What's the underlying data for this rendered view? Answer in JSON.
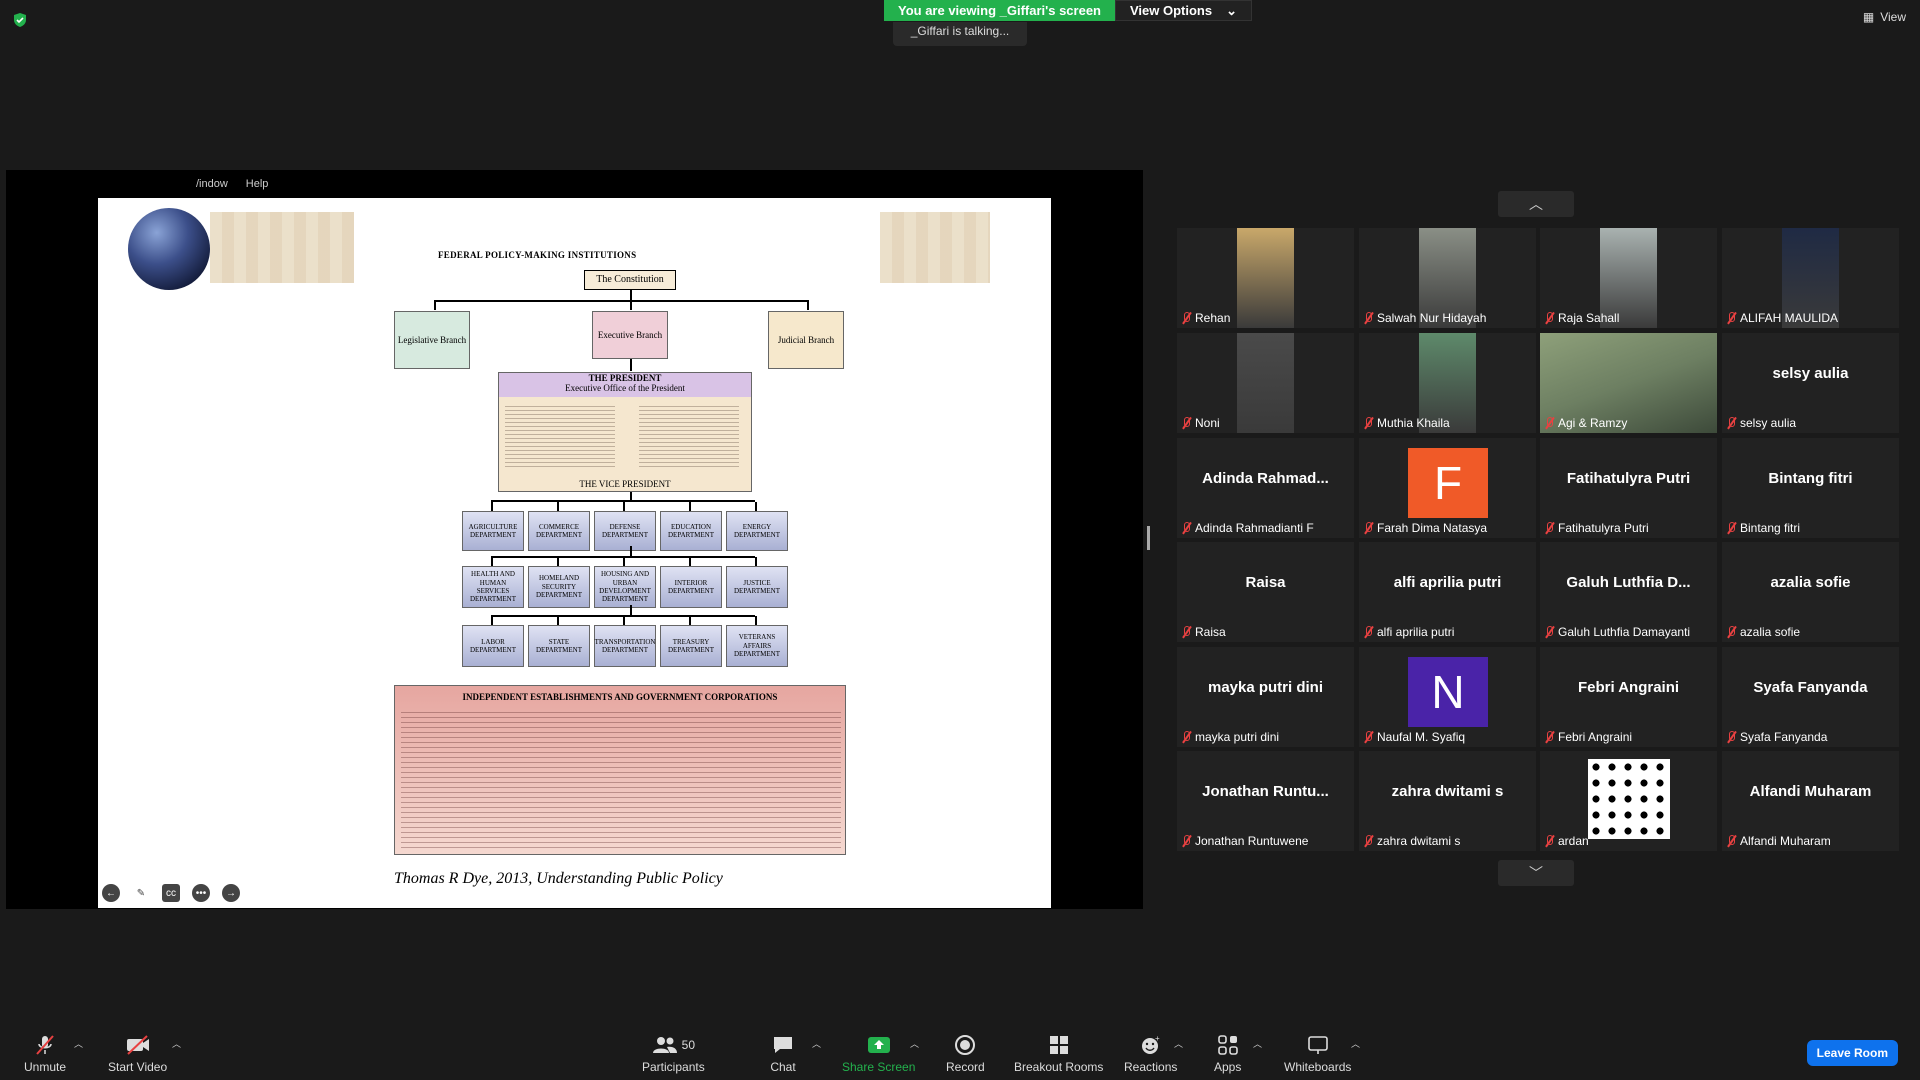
{
  "meeting": {
    "viewing_text": "You are viewing _Giffari's screen",
    "view_options_label": "View Options",
    "talking_text": "_Giffari is talking...",
    "view_label": "View"
  },
  "shared_screen": {
    "menu": [
      "/indow",
      "Help"
    ],
    "slide": {
      "title": "FEDERAL POLICY-MAKING INSTITUTIONS",
      "constitution": "The Constitution",
      "legislative": "Legislative Branch",
      "executive": "Executive Branch",
      "judicial": "Judicial Branch",
      "president_title": "THE PRESIDENT",
      "president_sub": "Executive Office of the President",
      "vice_president": "THE VICE PRESIDENT",
      "departments_row1": [
        "AGRICULTURE DEPARTMENT",
        "COMMERCE DEPARTMENT",
        "DEFENSE DEPARTMENT",
        "EDUCATION DEPARTMENT",
        "ENERGY DEPARTMENT"
      ],
      "departments_row2": [
        "HEALTH AND HUMAN SERVICES DEPARTMENT",
        "HOMELAND SECURITY DEPARTMENT",
        "HOUSING AND URBAN DEVELOPMENT DEPARTMENT",
        "INTERIOR DEPARTMENT",
        "JUSTICE DEPARTMENT"
      ],
      "departments_row3": [
        "LABOR DEPARTMENT",
        "STATE DEPARTMENT",
        "TRANSPORTATION DEPARTMENT",
        "TREASURY DEPARTMENT",
        "VETERANS AFFAIRS DEPARTMENT"
      ],
      "independent_title": "INDEPENDENT ESTABLISHMENTS AND GOVERNMENT CORPORATIONS",
      "caption": "Thomas R Dye, 2013, Understanding Public Policy"
    }
  },
  "gallery": {
    "tiles": [
      {
        "name": "Rehan",
        "big": "",
        "kind": "video",
        "color": "#c9a86a"
      },
      {
        "name": "Salwah Nur Hidayah",
        "big": "",
        "kind": "video",
        "color": "#8a8f86"
      },
      {
        "name": "Raja Sahall",
        "big": "",
        "kind": "video",
        "color": "#a9b2b0"
      },
      {
        "name": "ALIFAH MAULIDA",
        "big": "",
        "kind": "video",
        "color": "#1f2a44"
      },
      {
        "name": "Noni",
        "big": "",
        "kind": "video",
        "color": "#4a4a4a"
      },
      {
        "name": "Muthia Khaila",
        "big": "",
        "kind": "video",
        "color": "#5e8a6b"
      },
      {
        "name": "Agi & Ramzy",
        "big": "",
        "kind": "video-wide",
        "color": "#6d7f62"
      },
      {
        "name": "selsy aulia",
        "big": "selsy aulia",
        "kind": "text"
      },
      {
        "name": "Adinda Rahmadianti F",
        "big": "Adinda Rahmad...",
        "kind": "text"
      },
      {
        "name": "Farah Dima Natasya",
        "big": "F",
        "kind": "letter",
        "color": "#f05a28"
      },
      {
        "name": "Fatihatulyra Putri",
        "big": "Fatihatulyra Putri",
        "kind": "text"
      },
      {
        "name": "Bintang fitri",
        "big": "Bintang fitri",
        "kind": "text"
      },
      {
        "name": "Raisa",
        "big": "Raisa",
        "kind": "text"
      },
      {
        "name": "alfi aprilia putri",
        "big": "alfi aprilia putri",
        "kind": "text"
      },
      {
        "name": "Galuh Luthfia Damayanti",
        "big": "Galuh Luthfia D...",
        "kind": "text"
      },
      {
        "name": "azalia sofie",
        "big": "azalia sofie",
        "kind": "text"
      },
      {
        "name": "mayka putri dini",
        "big": "mayka putri dini",
        "kind": "text"
      },
      {
        "name": "Naufal M. Syafiq",
        "big": "N",
        "kind": "letter",
        "color": "#4a23a8"
      },
      {
        "name": "Febri Angraini",
        "big": "Febri Angraini",
        "kind": "text"
      },
      {
        "name": "Syafa Fanyanda",
        "big": "Syafa Fanyanda",
        "kind": "text"
      },
      {
        "name": "Jonathan Runtuwene",
        "big": "Jonathan Runtu...",
        "kind": "text"
      },
      {
        "name": "zahra dwitami s",
        "big": "zahra dwitami s",
        "kind": "text"
      },
      {
        "name": "ardan",
        "big": "",
        "kind": "pattern"
      },
      {
        "name": "Alfandi Muharam",
        "big": "Alfandi Muharam",
        "kind": "text"
      }
    ]
  },
  "toolbar": {
    "unmute": "Unmute",
    "start_video": "Start Video",
    "participants": "Participants",
    "participants_count": "50",
    "chat": "Chat",
    "share_screen": "Share Screen",
    "record": "Record",
    "breakout_rooms": "Breakout Rooms",
    "reactions": "Reactions",
    "apps": "Apps",
    "whiteboards": "Whiteboards",
    "leave_room": "Leave Room"
  },
  "colors": {
    "accent_green": "#23b14d",
    "accent_blue": "#0e72ed",
    "mute_red": "#e84141"
  }
}
